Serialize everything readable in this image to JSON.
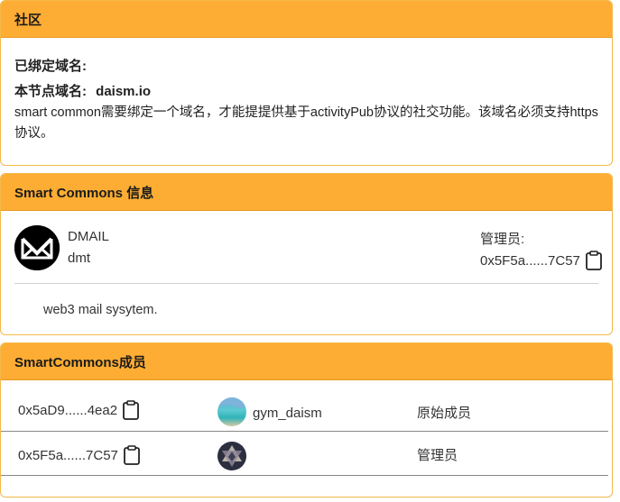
{
  "community": {
    "header": "社区",
    "bound_domain_label": "已绑定域名:",
    "node_domain_label": "本节点域名:",
    "node_domain_value": "daism.io",
    "description": "smart common需要绑定一个域名，才能提提供基于activityPub协议的社交功能。该域名必须支持https协议。"
  },
  "info": {
    "header": "Smart Commons 信息",
    "name": "DMAIL",
    "symbol": "dmt",
    "admin_label": "管理员:",
    "admin_address": "0x5F5a......7C57",
    "description": "web3 mail sysytem."
  },
  "members": {
    "header": "SmartCommons成员",
    "rows": [
      {
        "address": "0x5aD9......4ea2",
        "username": "gym_daism",
        "role": "原始成员"
      },
      {
        "address": "0x5F5a......7C57",
        "username": "",
        "role": "管理员"
      }
    ]
  },
  "icons": {
    "copy": "clipboard-icon",
    "logo": "mail-envelope-icon"
  },
  "colors": {
    "header_bg": "#fdad33",
    "border": "#f3b84a"
  }
}
